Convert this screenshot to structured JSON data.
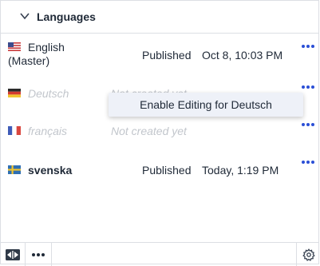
{
  "header": {
    "title": "Languages",
    "toggle_icon": "chevron-down-icon"
  },
  "languages": [
    {
      "name_line1": "English",
      "name_line2": "(Master)",
      "status": "Published",
      "date": "Oct 8, 10:03 PM",
      "flag": "us-flag-icon"
    },
    {
      "name": "Deutsch",
      "status": "Not created yet",
      "flag": "de-flag-icon",
      "disabled": true
    },
    {
      "name": "français",
      "status": "Not created yet",
      "flag": "fr-flag-icon",
      "disabled": true
    },
    {
      "name": "svenska",
      "status": "Published",
      "date": "Today, 1:19 PM",
      "flag": "se-flag-icon"
    }
  ],
  "context_menu": {
    "item_label": "Enable Editing for Deutsch"
  },
  "footer": {
    "left_icon": "swap-arrows-icon",
    "more_icon": "more-horizontal-icon",
    "settings_icon": "gear-icon"
  },
  "colors": {
    "accent": "#2b4fd6",
    "muted": "#c2c6cc",
    "border": "#dcdfe4"
  }
}
